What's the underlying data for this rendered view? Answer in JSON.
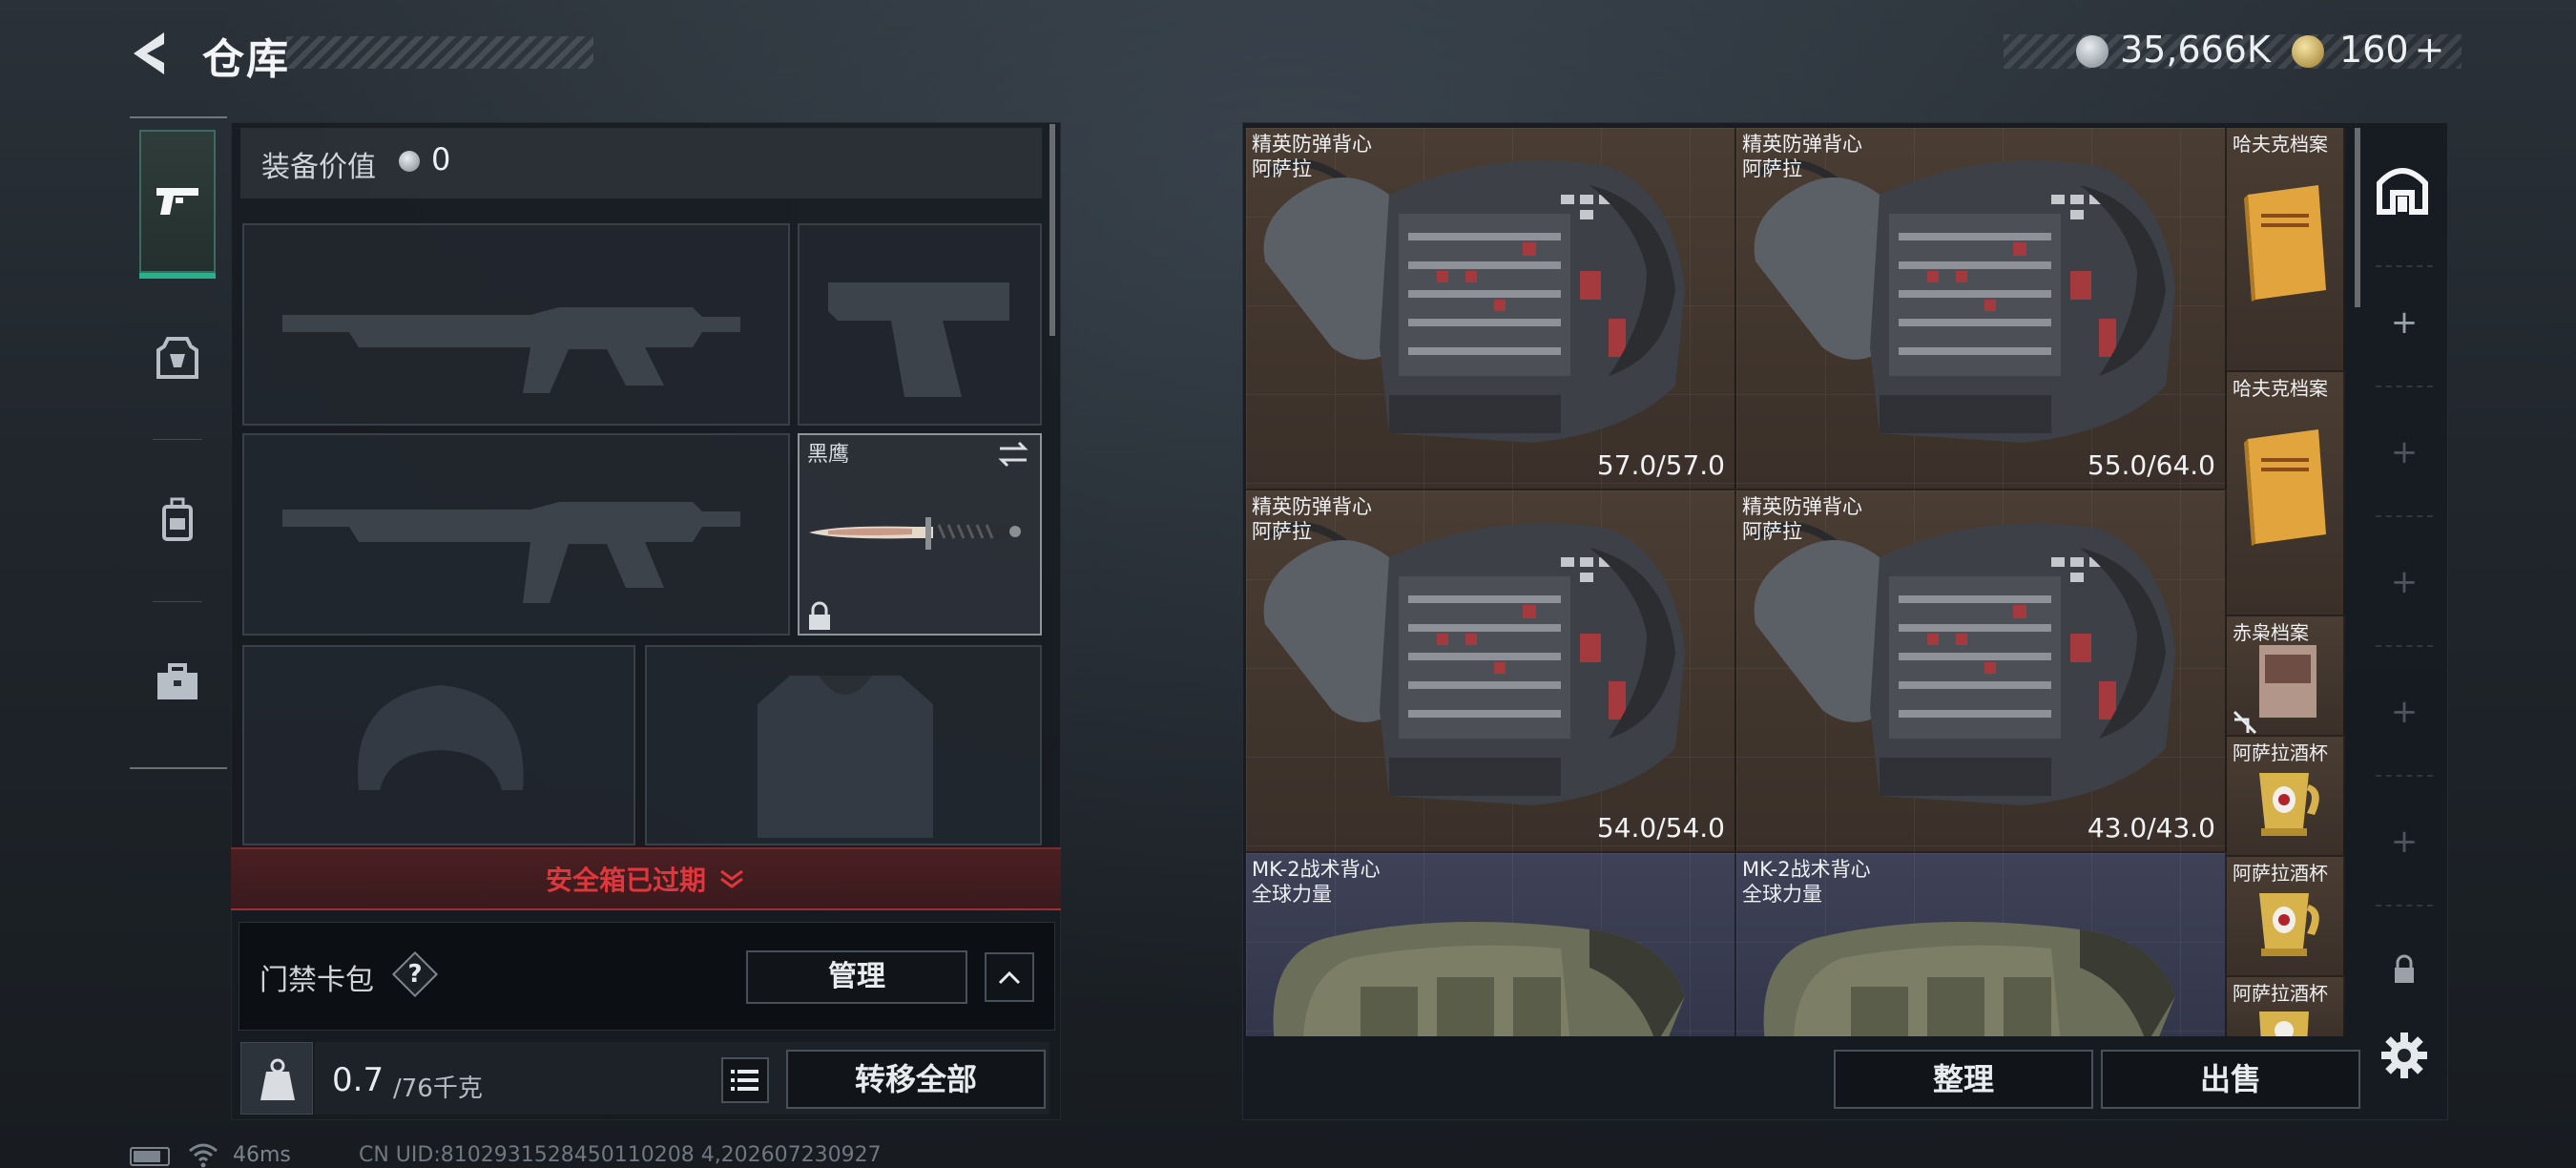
{
  "header": {
    "title": "仓库",
    "currency_primary": "35,666K",
    "currency_secondary": "160",
    "currency_secondary_suffix": "+"
  },
  "equipment": {
    "value_label": "装备价值",
    "value_amount": "0",
    "melee_name": "黑鹰",
    "safebox_status": "安全箱已过期",
    "card_label": "门禁卡包",
    "card_help": "?",
    "manage_label": "管理",
    "weight_value": "0.7",
    "weight_capacity": "/76千克",
    "transfer_all_label": "转移全部"
  },
  "storage": {
    "items": [
      {
        "name_line1": "精英防弹背心",
        "name_line2": "阿萨拉",
        "durability": "57.0/57.0"
      },
      {
        "name_line1": "精英防弹背心",
        "name_line2": "阿萨拉",
        "durability": "55.0/64.0"
      },
      {
        "name_line1": "精英防弹背心",
        "name_line2": "阿萨拉",
        "durability": "54.0/54.0"
      },
      {
        "name_line1": "精英防弹背心",
        "name_line2": "阿萨拉",
        "durability": "43.0/43.0"
      },
      {
        "name_line1": "MK-2战术背心",
        "name_line2": "全球力量",
        "durability": ""
      },
      {
        "name_line1": "MK-2战术背心",
        "name_line2": "全球力量",
        "durability": ""
      }
    ],
    "small_items": [
      {
        "name": "哈夫克档案"
      },
      {
        "name": "哈夫克档案"
      },
      {
        "name": "赤枭档案"
      },
      {
        "name": "阿萨拉酒杯"
      },
      {
        "name": "阿萨拉酒杯"
      },
      {
        "name": "阿萨拉酒杯"
      }
    ],
    "sort_label": "整理",
    "sell_label": "出售"
  },
  "status_bar": {
    "ping": "46ms",
    "uid": "CN UID:8102931528450110208 4,202607230927"
  },
  "colors": {
    "accent_green": "#29b08a",
    "danger_red": "#e0363c"
  },
  "icons": {
    "back": "chevron-left-icon",
    "tab_weapons": "pistol-icon",
    "tab_armor": "armor-icon",
    "tab_backpack": "backpack-icon",
    "tab_case": "briefcase-icon",
    "rail_home": "safehouse-icon",
    "rail_settings": "gear-icon"
  }
}
